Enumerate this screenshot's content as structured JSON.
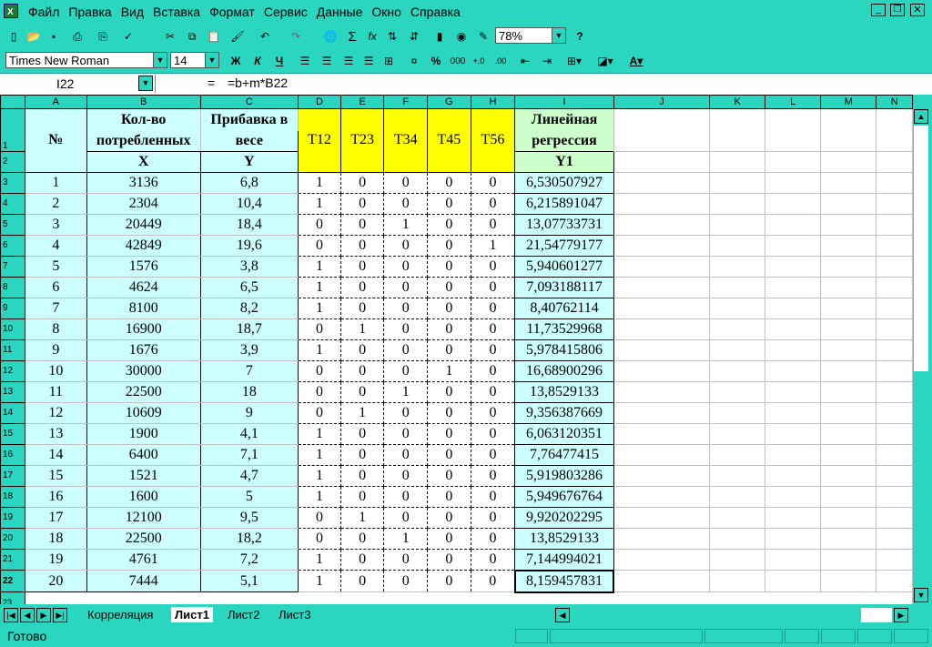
{
  "menu": [
    "Файл",
    "Правка",
    "Вид",
    "Вставка",
    "Формат",
    "Сервис",
    "Данные",
    "Окно",
    "Справка"
  ],
  "toolbar": {
    "zoom": "78%",
    "font_name": "Times New Roman",
    "font_size": "14",
    "bold": "Ж",
    "italic": "К",
    "underline": "Ч",
    "percent": "%",
    "thousands": "000",
    "sum": "Σ",
    "fx": "fx",
    "help": "?"
  },
  "formula_bar": {
    "cell_ref": "I22",
    "equals": "=",
    "formula": "=b+m*B22"
  },
  "columns": [
    "A",
    "B",
    "C",
    "D",
    "E",
    "F",
    "G",
    "H",
    "I",
    "J",
    "K",
    "L",
    "M",
    "N"
  ],
  "headers": {
    "no": "№",
    "b1": "Кол-во",
    "b2": "потребленных",
    "b3": "X",
    "c1": "Прибавка в",
    "c2": "весе",
    "c3": "Y",
    "d": "T12",
    "e": "T23",
    "f": "T34",
    "g": "T45",
    "h": "T56",
    "i1": "Линейная",
    "i2": "регрессия",
    "i3": "Y1"
  },
  "rows": [
    {
      "r": "3",
      "a": "1",
      "b": "3136",
      "c": "6,8",
      "d": "1",
      "e": "0",
      "f": "0",
      "g": "0",
      "h": "0",
      "i": "6,530507927"
    },
    {
      "r": "4",
      "a": "2",
      "b": "2304",
      "c": "10,4",
      "d": "1",
      "e": "0",
      "f": "0",
      "g": "0",
      "h": "0",
      "i": "6,215891047"
    },
    {
      "r": "5",
      "a": "3",
      "b": "20449",
      "c": "18,4",
      "d": "0",
      "e": "0",
      "f": "1",
      "g": "0",
      "h": "0",
      "i": "13,07733731"
    },
    {
      "r": "6",
      "a": "4",
      "b": "42849",
      "c": "19,6",
      "d": "0",
      "e": "0",
      "f": "0",
      "g": "0",
      "h": "1",
      "i": "21,54779177"
    },
    {
      "r": "7",
      "a": "5",
      "b": "1576",
      "c": "3,8",
      "d": "1",
      "e": "0",
      "f": "0",
      "g": "0",
      "h": "0",
      "i": "5,940601277"
    },
    {
      "r": "8",
      "a": "6",
      "b": "4624",
      "c": "6,5",
      "d": "1",
      "e": "0",
      "f": "0",
      "g": "0",
      "h": "0",
      "i": "7,093188117"
    },
    {
      "r": "9",
      "a": "7",
      "b": "8100",
      "c": "8,2",
      "d": "1",
      "e": "0",
      "f": "0",
      "g": "0",
      "h": "0",
      "i": "8,40762114"
    },
    {
      "r": "10",
      "a": "8",
      "b": "16900",
      "c": "18,7",
      "d": "0",
      "e": "1",
      "f": "0",
      "g": "0",
      "h": "0",
      "i": "11,73529968"
    },
    {
      "r": "11",
      "a": "9",
      "b": "1676",
      "c": "3,9",
      "d": "1",
      "e": "0",
      "f": "0",
      "g": "0",
      "h": "0",
      "i": "5,978415806"
    },
    {
      "r": "12",
      "a": "10",
      "b": "30000",
      "c": "7",
      "d": "0",
      "e": "0",
      "f": "0",
      "g": "1",
      "h": "0",
      "i": "16,68900296"
    },
    {
      "r": "13",
      "a": "11",
      "b": "22500",
      "c": "18",
      "d": "0",
      "e": "0",
      "f": "1",
      "g": "0",
      "h": "0",
      "i": "13,8529133"
    },
    {
      "r": "14",
      "a": "12",
      "b": "10609",
      "c": "9",
      "d": "0",
      "e": "1",
      "f": "0",
      "g": "0",
      "h": "0",
      "i": "9,356387669"
    },
    {
      "r": "15",
      "a": "13",
      "b": "1900",
      "c": "4,1",
      "d": "1",
      "e": "0",
      "f": "0",
      "g": "0",
      "h": "0",
      "i": "6,063120351"
    },
    {
      "r": "16",
      "a": "14",
      "b": "6400",
      "c": "7,1",
      "d": "1",
      "e": "0",
      "f": "0",
      "g": "0",
      "h": "0",
      "i": "7,76477415"
    },
    {
      "r": "17",
      "a": "15",
      "b": "1521",
      "c": "4,7",
      "d": "1",
      "e": "0",
      "f": "0",
      "g": "0",
      "h": "0",
      "i": "5,919803286"
    },
    {
      "r": "18",
      "a": "16",
      "b": "1600",
      "c": "5",
      "d": "1",
      "e": "0",
      "f": "0",
      "g": "0",
      "h": "0",
      "i": "5,949676764"
    },
    {
      "r": "19",
      "a": "17",
      "b": "12100",
      "c": "9,5",
      "d": "0",
      "e": "1",
      "f": "0",
      "g": "0",
      "h": "0",
      "i": "9,920202295"
    },
    {
      "r": "20",
      "a": "18",
      "b": "22500",
      "c": "18,2",
      "d": "0",
      "e": "0",
      "f": "1",
      "g": "0",
      "h": "0",
      "i": "13,8529133"
    },
    {
      "r": "21",
      "a": "19",
      "b": "4761",
      "c": "7,2",
      "d": "1",
      "e": "0",
      "f": "0",
      "g": "0",
      "h": "0",
      "i": "7,144994021"
    },
    {
      "r": "22",
      "a": "20",
      "b": "7444",
      "c": "5,1",
      "d": "1",
      "e": "0",
      "f": "0",
      "g": "0",
      "h": "0",
      "i": "8,159457831"
    }
  ],
  "row_labels": {
    "r1": "1",
    "r2": "2",
    "r23": "23"
  },
  "sheet_tabs": [
    "Корреляция",
    "Лист1",
    "Лист2",
    "Лист3"
  ],
  "active_tab": "Лист1",
  "status": "Готово",
  "colors": {
    "chrome": "#2ad6c0",
    "cyan_cells": "#ccffff",
    "yellow_cells": "#ffff00",
    "green_cells": "#ccffcc"
  }
}
